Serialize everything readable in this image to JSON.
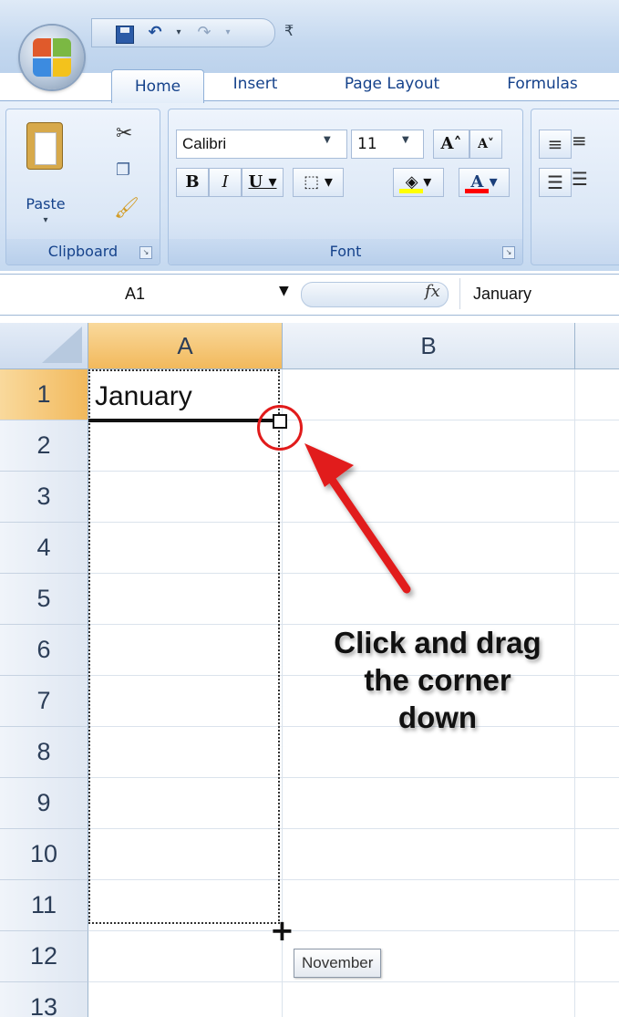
{
  "tabs": [
    "Home",
    "Insert",
    "Page Layout",
    "Formulas"
  ],
  "clipboard": {
    "paste_label": "Paste",
    "group_label": "Clipboard"
  },
  "font": {
    "name": "Calibri",
    "size": "11",
    "group_label": "Font",
    "fill_color": "#ffff00",
    "font_color": "#ff0000"
  },
  "formula_bar": {
    "name_box": "A1",
    "fx": "fx",
    "value": "January"
  },
  "grid": {
    "columns": [
      "A",
      "B"
    ],
    "rows": [
      "1",
      "2",
      "3",
      "4",
      "5",
      "6",
      "7",
      "8",
      "9",
      "10",
      "11",
      "12",
      "13"
    ],
    "cell_a1": "January",
    "active_cell": "A1"
  },
  "annotation": {
    "callout_lines": [
      "Click and drag",
      "the corner",
      "down"
    ],
    "arrow_color": "#e11b1b",
    "tooltip": "November"
  }
}
